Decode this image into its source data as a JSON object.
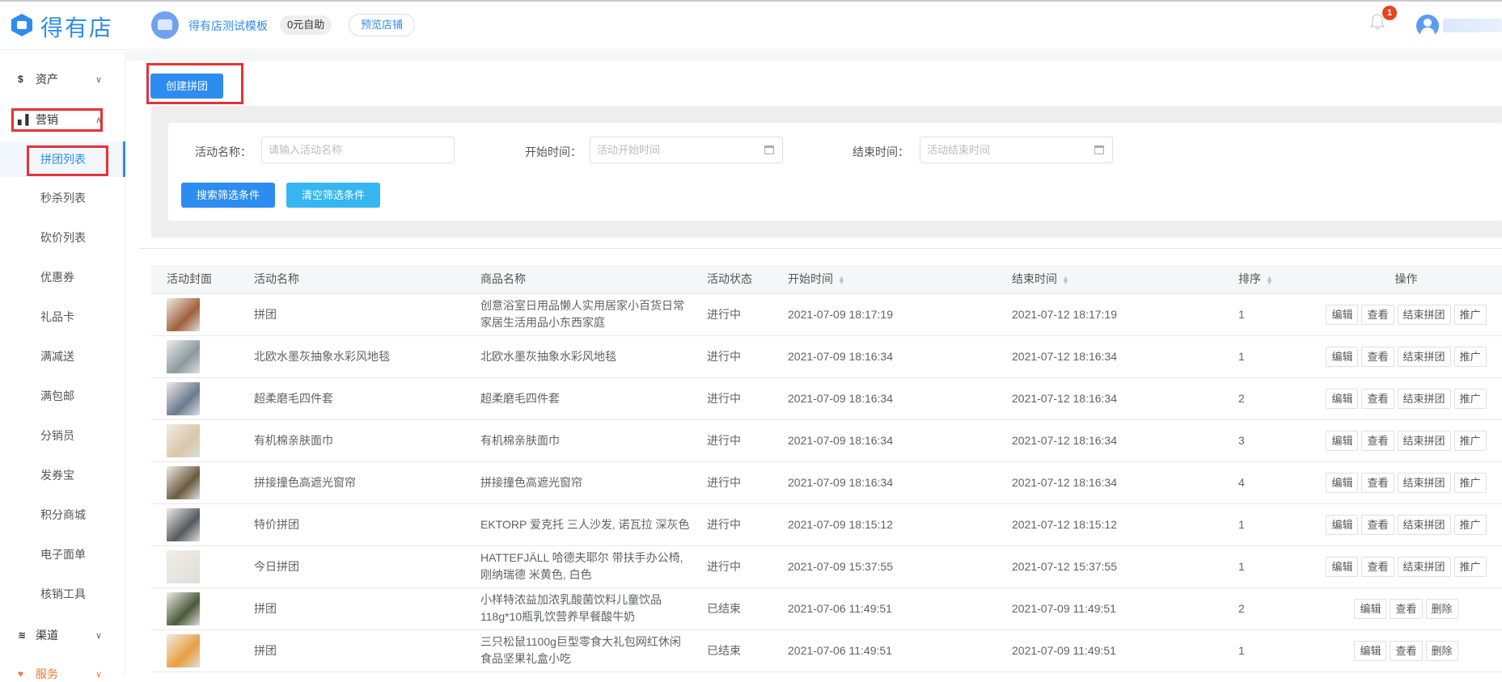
{
  "header": {
    "logo": "得有店",
    "store_name": "得有店测试模板",
    "plan_badge": "0元自助",
    "preview_button": "预览店铺",
    "notification_count": "1"
  },
  "sidebar": {
    "groups": {
      "assets": "资产",
      "marketing": "营销",
      "channels": "渠道",
      "services": "服务"
    },
    "items": [
      "拼团列表",
      "秒杀列表",
      "砍价列表",
      "优惠券",
      "礼品卡",
      "满减送",
      "满包邮",
      "分销员",
      "发券宝",
      "积分商城",
      "电子面单",
      "核销工具"
    ],
    "active_item": "拼团列表"
  },
  "toolbar": {
    "create_button": "创建拼团"
  },
  "filters": {
    "name_label": "活动名称：",
    "name_placeholder": "请输入活动名称",
    "start_label": "开始时间：",
    "start_placeholder": "活动开始时间",
    "end_label": "结束时间：",
    "end_placeholder": "活动结束时间",
    "search_button": "搜索筛选条件",
    "clear_button": "清空筛选条件"
  },
  "table": {
    "columns": [
      "活动封面",
      "活动名称",
      "商品名称",
      "活动状态",
      "开始时间",
      "结束时间",
      "排序",
      "操作"
    ],
    "rows": [
      {
        "name": "拼团",
        "product": "创意浴室日用品懒人实用居家小百货日常家居生活用品小东西家庭",
        "status": "进行中",
        "start": "2021-07-09 18:17:19",
        "end": "2021-07-12 18:17:19",
        "sort": "1",
        "actions": [
          "编辑",
          "查看",
          "结束拼团",
          "推广"
        ],
        "thumb_color": "#a0603a"
      },
      {
        "name": "北欧水墨灰抽象水彩风地毯",
        "product": "北欧水墨灰抽象水彩风地毯",
        "status": "进行中",
        "start": "2021-07-09 18:16:34",
        "end": "2021-07-12 18:16:34",
        "sort": "1",
        "actions": [
          "编辑",
          "查看",
          "结束拼团",
          "推广"
        ],
        "thumb_color": "#8a9aa0"
      },
      {
        "name": "超柔磨毛四件套",
        "product": "超柔磨毛四件套",
        "status": "进行中",
        "start": "2021-07-09 18:16:34",
        "end": "2021-07-12 18:16:34",
        "sort": "2",
        "actions": [
          "编辑",
          "查看",
          "结束拼团",
          "推广"
        ],
        "thumb_color": "#6a7a90"
      },
      {
        "name": "有机棉亲肤面巾",
        "product": "有机棉亲肤面巾",
        "status": "进行中",
        "start": "2021-07-09 18:16:34",
        "end": "2021-07-12 18:16:34",
        "sort": "3",
        "actions": [
          "编辑",
          "查看",
          "结束拼团",
          "推广"
        ],
        "thumb_color": "#d9c7a8"
      },
      {
        "name": "拼接撞色高遮光窗帘",
        "product": "拼接撞色高遮光窗帘",
        "status": "进行中",
        "start": "2021-07-09 18:16:34",
        "end": "2021-07-12 18:16:34",
        "sort": "4",
        "actions": [
          "编辑",
          "查看",
          "结束拼团",
          "推广"
        ],
        "thumb_color": "#6b5a3e"
      },
      {
        "name": "特价拼团",
        "product": "EKTORP 爱克托 三人沙发, 诺瓦拉 深灰色",
        "status": "进行中",
        "start": "2021-07-09 18:15:12",
        "end": "2021-07-12 18:15:12",
        "sort": "1",
        "actions": [
          "编辑",
          "查看",
          "结束拼团",
          "推广"
        ],
        "thumb_color": "#555a60"
      },
      {
        "name": "今日拼团",
        "product": "HATTEFJÄLL 哈德夫耶尔 带扶手办公椅, 刚纳瑞德 米黄色, 白色",
        "status": "进行中",
        "start": "2021-07-09 15:37:55",
        "end": "2021-07-12 15:37:55",
        "sort": "1",
        "actions": [
          "编辑",
          "查看",
          "结束拼团",
          "推广"
        ],
        "thumb_color": "#e6e4de"
      },
      {
        "name": "拼团",
        "product": "小样特浓益加浓乳酸菌饮料儿童饮品118g*10瓶乳饮营养早餐酸牛奶",
        "status": "已结束",
        "start": "2021-07-06 11:49:51",
        "end": "2021-07-09 11:49:51",
        "sort": "2",
        "actions": [
          "编辑",
          "查看",
          "删除"
        ],
        "thumb_color": "#4a5a3a"
      },
      {
        "name": "拼团",
        "product": "三只松鼠1100g巨型零食大礼包网红休闲食品坚果礼盒小吃",
        "status": "已结束",
        "start": "2021-07-06 11:49:51",
        "end": "2021-07-09 11:49:51",
        "sort": "1",
        "actions": [
          "编辑",
          "查看",
          "删除"
        ],
        "thumb_color": "#e8a040"
      }
    ]
  },
  "colors": {
    "primary": "#2d8cf0",
    "secondary": "#35b6f0",
    "highlight_box": "#e3333a",
    "badge": "#e8421f",
    "services": "#f07a30"
  }
}
